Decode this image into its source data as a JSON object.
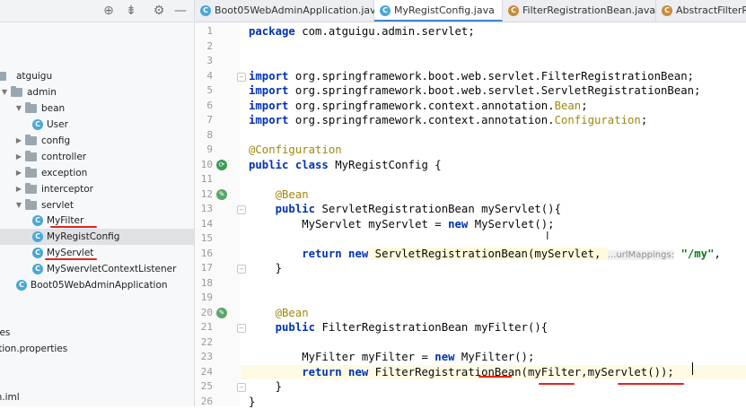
{
  "project": {
    "toolbar_icons": [
      "crosshair-icon",
      "collapse-icon",
      "gear-icon",
      "minimize-icon"
    ],
    "tree": [
      {
        "label": "atguigu",
        "kind": "folder"
      },
      {
        "label": "admin",
        "kind": "folder"
      },
      {
        "label": "bean",
        "kind": "folder"
      },
      {
        "label": "User",
        "kind": "class"
      },
      {
        "label": "config",
        "kind": "folder"
      },
      {
        "label": "controller",
        "kind": "folder"
      },
      {
        "label": "exception",
        "kind": "folder"
      },
      {
        "label": "interceptor",
        "kind": "folder"
      },
      {
        "label": "servlet",
        "kind": "folder"
      },
      {
        "label": "MyFilter",
        "kind": "class"
      },
      {
        "label": "MyRegistConfig",
        "kind": "class",
        "selected": true
      },
      {
        "label": "MyServlet",
        "kind": "class"
      },
      {
        "label": "MySwervletContextListener",
        "kind": "class"
      },
      {
        "label": "Boot05WebAdminApplication",
        "kind": "class"
      },
      {
        "label": "s",
        "kind": "text"
      },
      {
        "label": "c",
        "kind": "text"
      },
      {
        "label": "lates",
        "kind": "text"
      },
      {
        "label": "cation.properties",
        "kind": "text"
      },
      {
        "label": "nin.iml",
        "kind": "text"
      }
    ]
  },
  "tabs": [
    {
      "label": "Boot05WebAdminApplication.java"
    },
    {
      "label": "MyRegistConfig.java",
      "active": true
    },
    {
      "label": "FilterRegistrationBean.java"
    },
    {
      "label": "AbstractFilterRe"
    }
  ],
  "editor": {
    "lines": [
      {
        "n": "1",
        "parts": [
          [
            "kw",
            "package"
          ],
          [
            "",
            "com.atguigu.admin.servlet;"
          ]
        ]
      },
      {
        "n": "2",
        "parts": []
      },
      {
        "n": "3",
        "parts": []
      },
      {
        "n": "4",
        "parts": [
          [
            "kw",
            "import"
          ],
          [
            "",
            "org.springframework.boot.web.servlet.FilterRegistrationBean;"
          ]
        ]
      },
      {
        "n": "5",
        "parts": [
          [
            "kw",
            "import"
          ],
          [
            "",
            "org.springframework.boot.web.servlet.ServletRegistrationBean;"
          ]
        ]
      },
      {
        "n": "6",
        "parts": [
          [
            "kw",
            "import"
          ],
          [
            "",
            "org.springframework.context.annotation."
          ],
          [
            "ann",
            "Bean"
          ],
          [
            "",
            ";"
          ]
        ]
      },
      {
        "n": "7",
        "parts": [
          [
            "kw",
            "import"
          ],
          [
            "",
            "org.springframework.context.annotation."
          ],
          [
            "ann",
            "Configuration"
          ],
          [
            "",
            ";"
          ]
        ]
      },
      {
        "n": "8",
        "parts": []
      },
      {
        "n": "9",
        "parts": [
          [
            "ann",
            "@Configuration"
          ]
        ]
      },
      {
        "n": "10",
        "parts": [
          [
            "kw",
            "public class"
          ],
          [
            "",
            " MyRegistConfig {"
          ]
        ]
      },
      {
        "n": "11",
        "parts": []
      },
      {
        "n": "12",
        "parts": [
          [
            "ann",
            "    @Bean"
          ]
        ]
      },
      {
        "n": "13",
        "parts": [
          [
            "kw",
            "    public"
          ],
          [
            "",
            " ServletRegistrationBean myServlet(){"
          ]
        ]
      },
      {
        "n": "14",
        "parts": [
          [
            "",
            "        MyServlet myServlet = "
          ],
          [
            "kw",
            "new"
          ],
          [
            "",
            " MyServlet();"
          ]
        ]
      },
      {
        "n": "15",
        "parts": []
      },
      {
        "n": "16",
        "parts": [
          [
            "kw",
            "        return new"
          ],
          [
            "hl",
            " ServletRegistrationBean(myServlet, "
          ],
          [
            "hint",
            "...urlMappings:"
          ],
          [
            "str",
            " \"/my\""
          ],
          [
            "",
            ","
          ]
        ]
      },
      {
        "n": "17",
        "parts": [
          [
            "",
            "    }"
          ]
        ]
      },
      {
        "n": "18",
        "parts": []
      },
      {
        "n": "19",
        "parts": []
      },
      {
        "n": "20",
        "parts": [
          [
            "ann",
            "    @Bean"
          ]
        ]
      },
      {
        "n": "21",
        "parts": [
          [
            "kw",
            "    public"
          ],
          [
            "",
            " FilterRegistrationBean myFilter(){"
          ]
        ]
      },
      {
        "n": "22",
        "parts": []
      },
      {
        "n": "23",
        "parts": [
          [
            "",
            "        MyFilter myFilter = "
          ],
          [
            "kw",
            "new"
          ],
          [
            "",
            " MyFilter();"
          ]
        ]
      },
      {
        "n": "24",
        "parts": [
          [
            "kw",
            "        return new"
          ],
          [
            "",
            " FilterRegistrationBean(myFilter,myServlet());"
          ]
        ],
        "current": true
      },
      {
        "n": "25",
        "parts": [
          [
            "",
            "    }"
          ]
        ]
      },
      {
        "n": "26",
        "parts": [
          [
            "",
            "}"
          ]
        ]
      }
    ]
  },
  "colors": {
    "keyword": "#0033b3",
    "annotation": "#9e880d",
    "string": "#067d17",
    "underline": "#e8211d",
    "tab_active": "#4083c9"
  }
}
